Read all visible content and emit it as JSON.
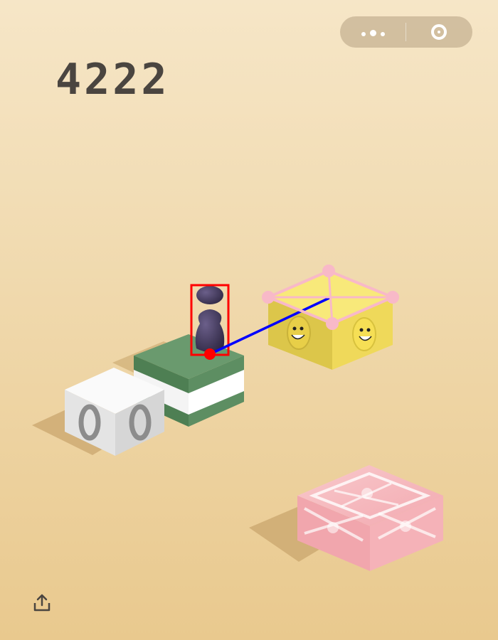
{
  "score": "4222",
  "top_capsule": {
    "more_icon": "more-dots-icon",
    "close_icon": "target-ring-icon"
  },
  "share": {
    "icon": "share-upload-icon"
  },
  "colors": {
    "bg_top": "#f6e6c7",
    "bg_bottom": "#e9c98e",
    "score_text": "#4a4540",
    "green_block": "#5a8a5e",
    "white_block": "#f2f2f2",
    "yellow_block": "#f2de5e",
    "pink_block": "#f4b7bd",
    "player": "#3d3454",
    "bbox": "#ff0000",
    "trajectory": "#0000ff",
    "landmarks": "#f8b9c8"
  }
}
